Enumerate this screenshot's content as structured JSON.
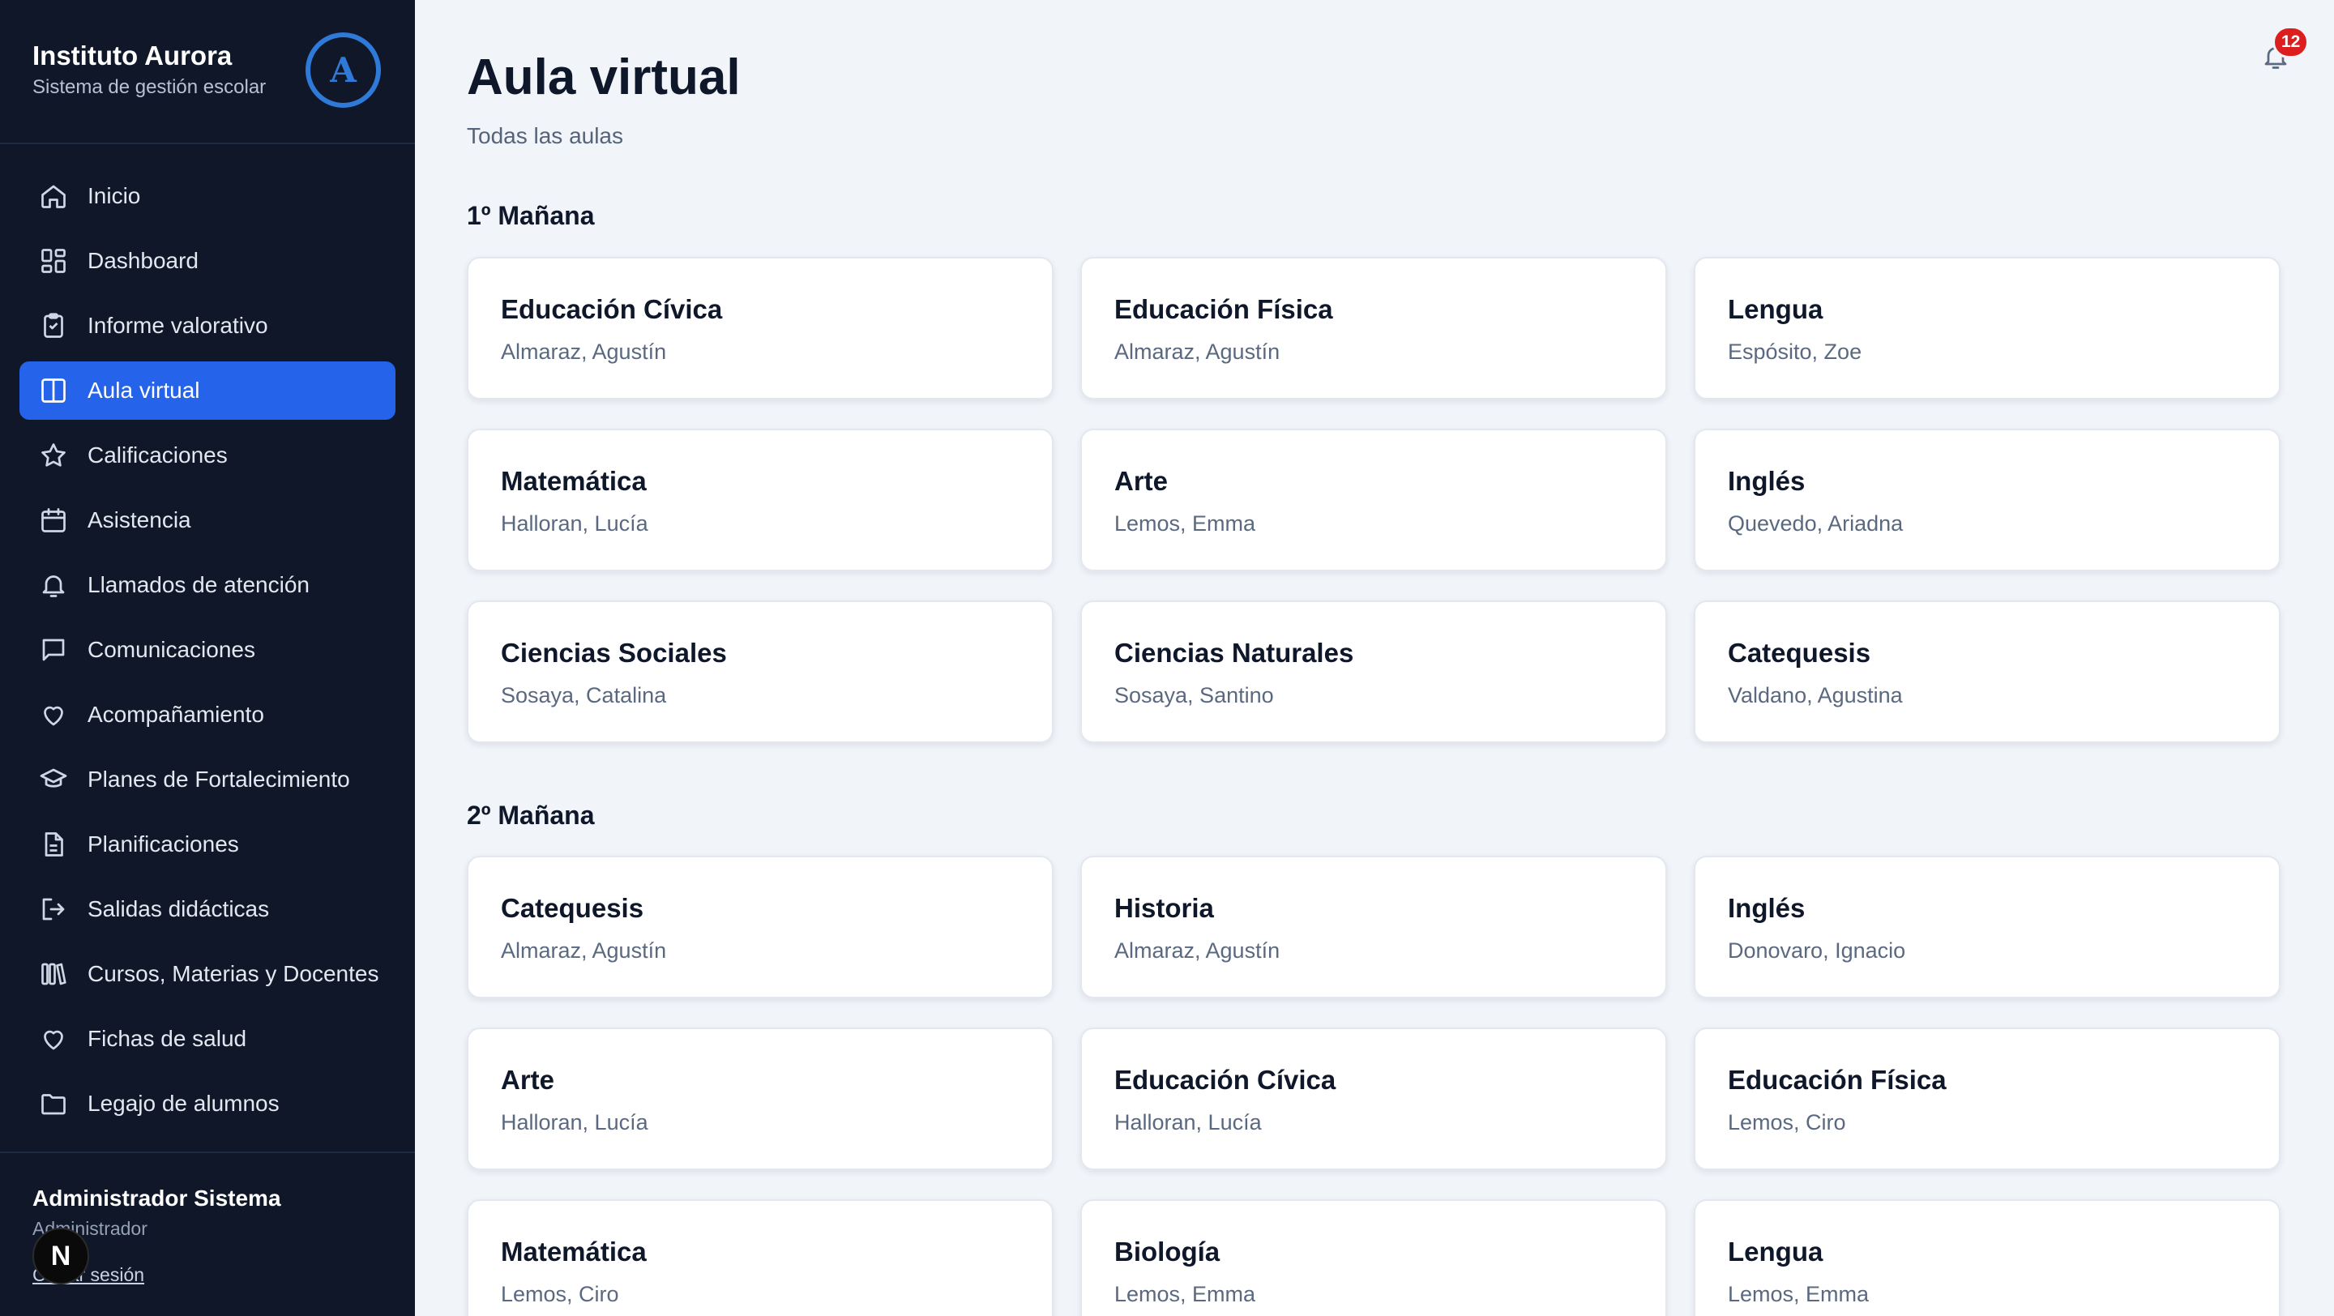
{
  "brand": {
    "title": "Instituto Aurora",
    "subtitle": "Sistema de gestión escolar",
    "logo_letter": "A"
  },
  "nav": {
    "items": [
      {
        "label": "Inicio",
        "icon": "home-icon",
        "active": false
      },
      {
        "label": "Dashboard",
        "icon": "grid-icon",
        "active": false
      },
      {
        "label": "Informe valorativo",
        "icon": "clipboard-icon",
        "active": false
      },
      {
        "label": "Aula virtual",
        "icon": "columns-icon",
        "active": true
      },
      {
        "label": "Calificaciones",
        "icon": "star-icon",
        "active": false
      },
      {
        "label": "Asistencia",
        "icon": "calendar-icon",
        "active": false
      },
      {
        "label": "Llamados de atención",
        "icon": "bell-icon",
        "active": false
      },
      {
        "label": "Comunicaciones",
        "icon": "message-icon",
        "active": false
      },
      {
        "label": "Acompañamiento",
        "icon": "heart-icon",
        "active": false
      },
      {
        "label": "Planes de Fortalecimiento",
        "icon": "graduation-cap-icon",
        "active": false
      },
      {
        "label": "Planificaciones",
        "icon": "file-text-icon",
        "active": false
      },
      {
        "label": "Salidas didácticas",
        "icon": "exit-icon",
        "active": false
      },
      {
        "label": "Cursos, Materias y Docentes",
        "icon": "library-icon",
        "active": false
      },
      {
        "label": "Fichas de salud",
        "icon": "heart-icon",
        "active": false
      },
      {
        "label": "Legajo de alumnos",
        "icon": "folder-icon",
        "active": false
      }
    ]
  },
  "user": {
    "name": "Administrador Sistema",
    "role": "Administrador",
    "logout_label": "Cerrar sesión",
    "badge_letter": "N"
  },
  "header": {
    "title": "Aula virtual",
    "subtitle": "Todas las aulas",
    "notification_count": "12"
  },
  "sections": [
    {
      "title": "1º Mañana",
      "cards": [
        {
          "subject": "Educación Cívica",
          "teacher": "Almaraz, Agustín"
        },
        {
          "subject": "Educación Física",
          "teacher": "Almaraz, Agustín"
        },
        {
          "subject": "Lengua",
          "teacher": "Espósito, Zoe"
        },
        {
          "subject": "Matemática",
          "teacher": "Halloran, Lucía"
        },
        {
          "subject": "Arte",
          "teacher": "Lemos, Emma"
        },
        {
          "subject": "Inglés",
          "teacher": "Quevedo, Ariadna"
        },
        {
          "subject": "Ciencias Sociales",
          "teacher": "Sosaya, Catalina"
        },
        {
          "subject": "Ciencias Naturales",
          "teacher": "Sosaya, Santino"
        },
        {
          "subject": "Catequesis",
          "teacher": "Valdano, Agustina"
        }
      ]
    },
    {
      "title": "2º Mañana",
      "cards": [
        {
          "subject": "Catequesis",
          "teacher": "Almaraz, Agustín"
        },
        {
          "subject": "Historia",
          "teacher": "Almaraz, Agustín"
        },
        {
          "subject": "Inglés",
          "teacher": "Donovaro, Ignacio"
        },
        {
          "subject": "Arte",
          "teacher": "Halloran, Lucía"
        },
        {
          "subject": "Educación Cívica",
          "teacher": "Halloran, Lucía"
        },
        {
          "subject": "Educación Física",
          "teacher": "Lemos, Ciro"
        },
        {
          "subject": "Matemática",
          "teacher": "Lemos, Ciro"
        },
        {
          "subject": "Biología",
          "teacher": "Lemos, Emma"
        },
        {
          "subject": "Lengua",
          "teacher": "Lemos, Emma"
        }
      ]
    }
  ],
  "colors": {
    "sidebar_bg": "#0f1729",
    "active_nav": "#2563eb",
    "page_bg": "#f1f4f9",
    "badge_red": "#dc1e1e",
    "logo_blue": "#2f7ad8"
  }
}
